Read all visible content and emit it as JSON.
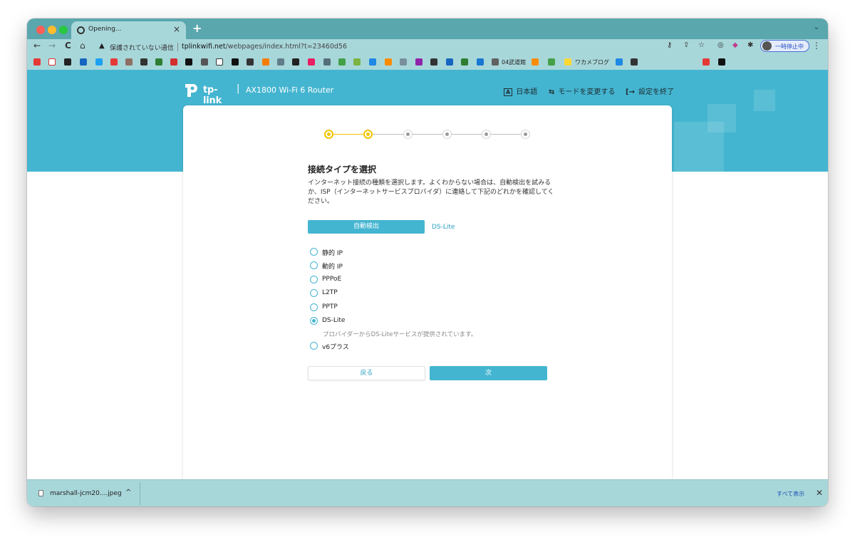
{
  "browser": {
    "tab_title": "Opening...",
    "tab_close": "×",
    "new_tab": "+",
    "tabstrip_chevron": "⌄",
    "nav": {
      "back": "←",
      "forward": "→",
      "reload": "C",
      "home": "⌂"
    },
    "security_label": "保護されていない通信",
    "url_domain": "tplinkwifi.net",
    "url_path": "/webpages/index.html?t=23460d56",
    "profile_label": "一時停止中",
    "menu": "⋮",
    "bookmark_labels": {
      "folder": "04武道館",
      "blog": "ワカメブログ"
    }
  },
  "header": {
    "brand": "tp-link",
    "divider": "|",
    "model": "AX1800 Wi-Fi 6 Router",
    "actions": {
      "language": {
        "icon": "A",
        "label": "日本語"
      },
      "mode": {
        "icon": "⇆",
        "label": "モードを変更する"
      },
      "exit": {
        "icon": "[→",
        "label": "設定を終了"
      }
    }
  },
  "wizard": {
    "steps": {
      "total": 6,
      "active": 2
    },
    "title": "接続タイプを選択",
    "description": "インターネット接続の種類を選択します。よくわからない場合は、自動検出を試みるか、ISP（インターネットサービスプロバイダ）に連絡して下記のどれかを確認してください。",
    "auto_detect_button": "自動検出",
    "detected_result": "DS-Lite",
    "options": [
      {
        "label": "静的 IP",
        "checked": false
      },
      {
        "label": "動的 IP",
        "checked": false
      },
      {
        "label": "PPPoE",
        "checked": false
      },
      {
        "label": "L2TP",
        "checked": false
      },
      {
        "label": "PPTP",
        "checked": false
      },
      {
        "label": "DS-Lite",
        "checked": true
      },
      {
        "label": "v6プラス",
        "checked": false
      }
    ],
    "dslite_note": "プロバイダーからDS-Liteサービスが提供されています。",
    "back_button": "戻る",
    "next_button": "次"
  },
  "downloads": {
    "filename": "marshall-jcm20....jpeg",
    "chevron": "^",
    "show_all": "すべて表示",
    "close": "✕"
  },
  "colors": {
    "accent": "#44b5d0",
    "step_active": "#f1c400",
    "chrome": "#a8d7da"
  }
}
